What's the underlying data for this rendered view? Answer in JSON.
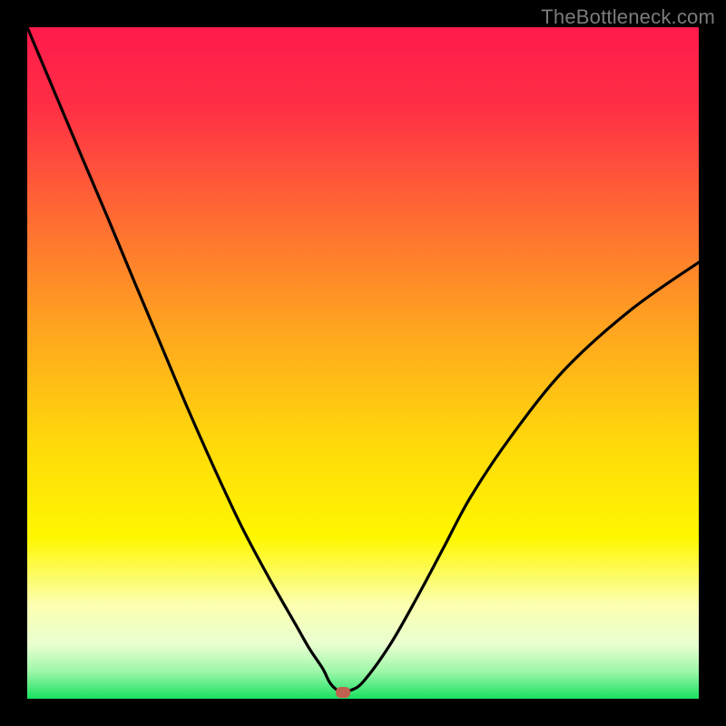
{
  "watermark": "TheBottleneck.com",
  "chart_data": {
    "type": "line",
    "title": "",
    "xlabel": "",
    "ylabel": "",
    "xlim": [
      0,
      100
    ],
    "ylim": [
      0,
      100
    ],
    "grid": false,
    "legend": false,
    "gradient_stops": [
      {
        "pct": 0,
        "color": "#ff1a4b"
      },
      {
        "pct": 12,
        "color": "#ff2f45"
      },
      {
        "pct": 28,
        "color": "#ff6a33"
      },
      {
        "pct": 45,
        "color": "#ffa51f"
      },
      {
        "pct": 62,
        "color": "#ffd90a"
      },
      {
        "pct": 76,
        "color": "#fff700"
      },
      {
        "pct": 86,
        "color": "#fbffb0"
      },
      {
        "pct": 92,
        "color": "#e8ffd0"
      },
      {
        "pct": 96,
        "color": "#9cf7a8"
      },
      {
        "pct": 100,
        "color": "#18e060"
      }
    ],
    "series": [
      {
        "name": "bottleneck-curve",
        "color": "#000000",
        "x": [
          0,
          4,
          8,
          12,
          16,
          20,
          24,
          28,
          32,
          36,
          40,
          42,
          44,
          45,
          46,
          47,
          48,
          50,
          54,
          58,
          62,
          66,
          72,
          80,
          90,
          100
        ],
        "y": [
          100,
          90.5,
          81,
          71.6,
          62,
          52.5,
          43,
          34,
          25.5,
          18,
          11,
          7.5,
          4.5,
          2.5,
          1.4,
          1.0,
          1.2,
          2.5,
          8,
          15,
          22.5,
          30,
          39,
          49,
          58,
          65
        ]
      }
    ],
    "marker": {
      "x": 47,
      "y": 1.0,
      "color": "#c0614f"
    }
  }
}
